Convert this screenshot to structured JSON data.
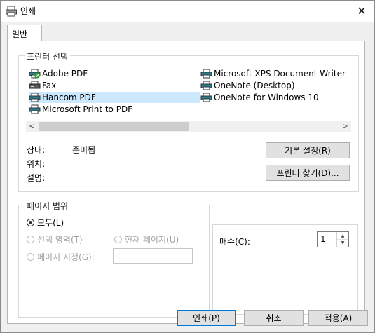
{
  "window": {
    "title": "인쇄",
    "icon": "printer-icon",
    "close_icon": "close-icon",
    "close_glyph": "✕"
  },
  "tab": {
    "label": "일반"
  },
  "printer_select": {
    "title": "프린터 선택",
    "printers": [
      {
        "name": "Adobe PDF",
        "icon": "printer-default-icon",
        "selected": false
      },
      {
        "name": "Fax",
        "icon": "fax-icon",
        "selected": false
      },
      {
        "name": "Hancom PDF",
        "icon": "printer-icon",
        "selected": true
      },
      {
        "name": "Microsoft Print to PDF",
        "icon": "printer-icon",
        "selected": false
      },
      {
        "name": "Microsoft XPS Document Writer",
        "icon": "printer-icon",
        "selected": false
      },
      {
        "name": "OneNote (Desktop)",
        "icon": "printer-icon",
        "selected": false
      },
      {
        "name": "OneNote for Windows 10",
        "icon": "printer-icon",
        "selected": false
      }
    ],
    "scroll_left": "<",
    "scroll_right": ">",
    "status_label": "상태:",
    "status_value": "준비됨",
    "location_label": "위치:",
    "comment_label": "설명:",
    "preferences_button": "기본 설정(R)",
    "find_printer_button": "프린터 찾기(D)..."
  },
  "page_range": {
    "title": "페이지 범위",
    "all": "모두(L)",
    "selection": "선택 영역(T)",
    "current_page": "현재 페이지(U)",
    "pages": "페이지 지정(G):"
  },
  "copies": {
    "label": "매수(C):",
    "value": "1"
  },
  "footer": {
    "print": "인쇄(P)",
    "cancel": "취소",
    "apply": "적용(A)"
  },
  "colors": {
    "selection": "#cce8ff",
    "accent": "#0078d7",
    "printer_teal": "#2a7f8f",
    "check_green": "#2e9e3a"
  }
}
